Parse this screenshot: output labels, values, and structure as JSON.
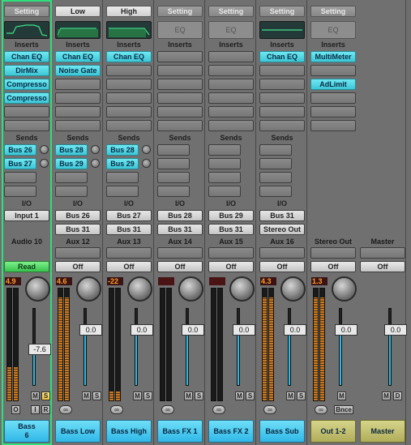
{
  "sections": {
    "inserts": "Inserts",
    "sends": "Sends",
    "io": "I/O"
  },
  "strips": [
    {
      "setting": "Setting",
      "setting_light": false,
      "eq_type": "curve",
      "inserts": [
        "Chan EQ",
        "DirMix",
        "Compresso",
        "Compresso"
      ],
      "sends": [
        "Bus 26",
        "Bus 27"
      ],
      "input": "Input 1",
      "output": "",
      "name": "Audio 10",
      "automation": "Read",
      "peak": "4.9",
      "fader": "-7.6",
      "buttons": [
        "M",
        "S"
      ],
      "bottom_buttons": [
        "O",
        "I",
        "R"
      ],
      "channel": "Bass\n6",
      "channel_lines": [
        "Bass",
        "6"
      ],
      "out": false
    },
    {
      "setting": "Low",
      "setting_light": true,
      "eq_type": "curve",
      "inserts": [
        "Chan EQ",
        "Noise Gate"
      ],
      "sends": [
        "Bus 28",
        "Bus 29"
      ],
      "input": "Bus 26",
      "output": "Bus 31",
      "name": "Aux 12",
      "automation": "Off",
      "peak": "4.6",
      "fader": "0.0",
      "buttons": [
        "M",
        "S"
      ],
      "bottom_buttons": [],
      "channel_lines": [
        "Bass Low"
      ],
      "out": false
    },
    {
      "setting": "High",
      "setting_light": true,
      "eq_type": "curve",
      "inserts": [
        "Chan EQ"
      ],
      "sends": [
        "Bus 28",
        "Bus 29"
      ],
      "input": "Bus 27",
      "output": "Bus 31",
      "name": "Aux 13",
      "automation": "Off",
      "peak": "-22",
      "fader": "0.0",
      "buttons": [
        "M",
        "S"
      ],
      "bottom_buttons": [],
      "channel_lines": [
        "Bass High"
      ],
      "out": false
    },
    {
      "setting": "Setting",
      "setting_light": false,
      "eq_type": "label",
      "eq_label": "EQ",
      "inserts": [],
      "sends": [],
      "input": "Bus 28",
      "output": "Bus 31",
      "name": "Aux 14",
      "automation": "Off",
      "peak": "",
      "fader": "0.0",
      "buttons": [
        "M",
        "S"
      ],
      "bottom_buttons": [],
      "channel_lines": [
        "Bass FX 1"
      ],
      "out": false
    },
    {
      "setting": "Setting",
      "setting_light": false,
      "eq_type": "label",
      "eq_label": "EQ",
      "inserts": [],
      "sends": [],
      "input": "Bus 29",
      "output": "Bus 31",
      "name": "Aux 15",
      "automation": "Off",
      "peak": "",
      "fader": "0.0",
      "buttons": [
        "M",
        "S"
      ],
      "bottom_buttons": [],
      "channel_lines": [
        "Bass FX 2"
      ],
      "out": false
    },
    {
      "setting": "Setting",
      "setting_light": false,
      "eq_type": "curve",
      "inserts": [
        "Chan EQ"
      ],
      "sends": [],
      "input": "Bus 31",
      "output": "Stereo Out",
      "name": "Aux 16",
      "automation": "Off",
      "peak": "4.3",
      "fader": "0.0",
      "buttons": [
        "M",
        "S"
      ],
      "bottom_buttons": [],
      "channel_lines": [
        "Bass Sub"
      ],
      "out": false
    },
    {
      "setting": "Setting",
      "setting_light": false,
      "eq_type": "label",
      "eq_label": "EQ",
      "inserts": [
        "MultiMeter",
        "",
        "AdLimit"
      ],
      "sends": [],
      "input": "",
      "output": "",
      "name": "Stereo Out",
      "automation": "Off",
      "peak": "1.3",
      "fader": "0.0",
      "buttons": [
        "M"
      ],
      "bnce": "Bnce",
      "bottom_buttons": [],
      "channel_lines": [
        "Out 1-2"
      ],
      "out": true
    },
    {
      "setting": "",
      "setting_light": false,
      "eq_type": "none",
      "inserts": [],
      "sends": [],
      "input": "",
      "output": "",
      "name": "Master",
      "automation": "Off",
      "peak": "",
      "fader": "0.0",
      "buttons": [
        "M",
        "D"
      ],
      "bottom_buttons": [],
      "channel_lines": [
        "Master"
      ],
      "out": true
    }
  ],
  "colors": {
    "plugin": "#4fd6e4",
    "selected_outline": "#2ee07a",
    "read": "#39c24f",
    "meter": "#c8791f"
  }
}
